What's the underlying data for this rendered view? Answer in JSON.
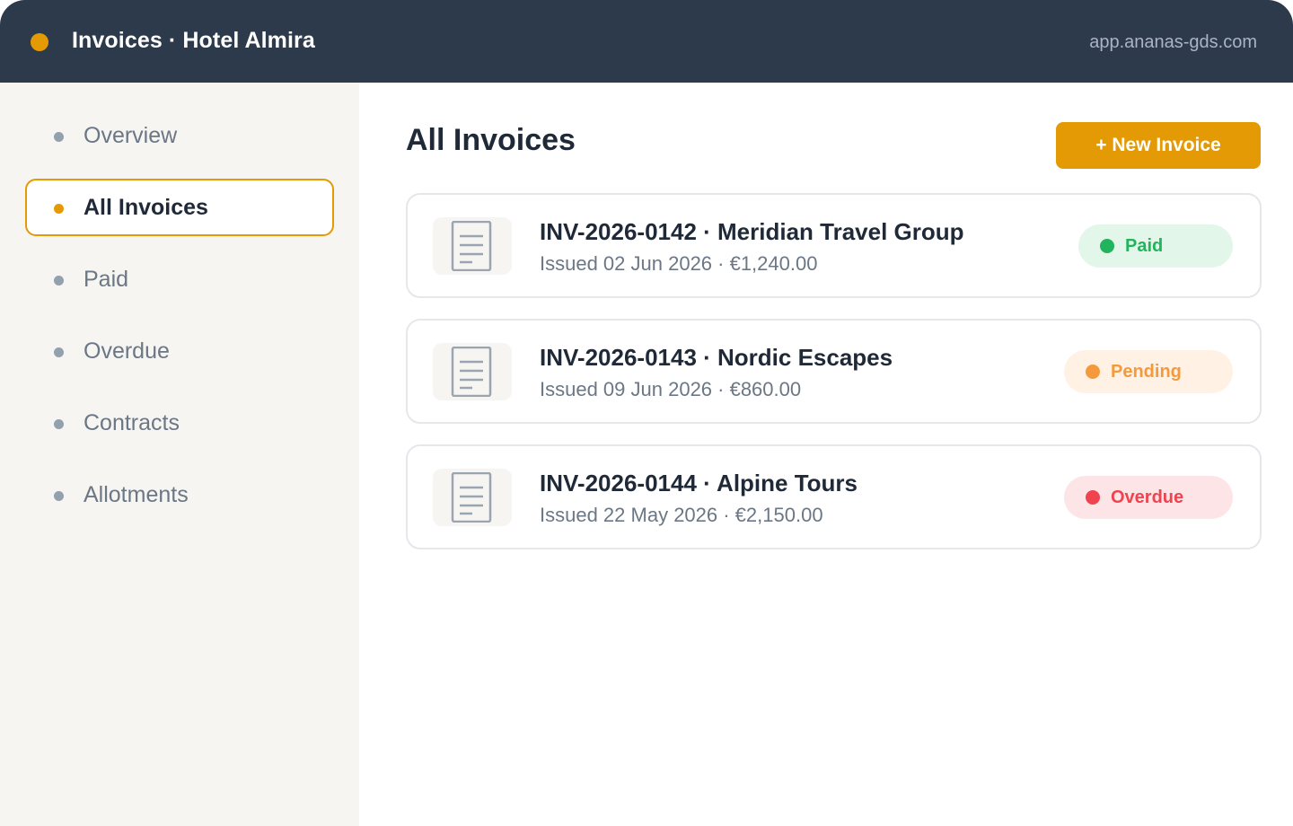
{
  "header": {
    "title": "Invoices · Hotel Almira",
    "url": "app.ananas-gds.com"
  },
  "sidebar": {
    "items": [
      {
        "label": "Overview",
        "active": false
      },
      {
        "label": "All Invoices",
        "active": true
      },
      {
        "label": "Paid",
        "active": false
      },
      {
        "label": "Overdue",
        "active": false
      },
      {
        "label": "Contracts",
        "active": false
      },
      {
        "label": "Allotments",
        "active": false
      }
    ]
  },
  "main": {
    "title": "All Invoices",
    "new_button_label": "+ New Invoice",
    "invoices": [
      {
        "title": "INV-2026-0142 · Meridian Travel Group",
        "meta": "Issued 02 Jun 2026 · €1,240.00",
        "status": "Paid"
      },
      {
        "title": "INV-2026-0143 · Nordic Escapes",
        "meta": "Issued 09 Jun 2026 · €860.00",
        "status": "Pending"
      },
      {
        "title": "INV-2026-0144 · Alpine Tours",
        "meta": "Issued 22 May 2026 · €2,150.00",
        "status": "Overdue"
      }
    ]
  },
  "colors": {
    "accent": "#e39a04",
    "header_bg": "#2d3a4b",
    "paid_bg": "#e3f6ea",
    "paid_fg": "#22b45c",
    "pending_bg": "#fff2e4",
    "pending_fg": "#f59a3c",
    "overdue_bg": "#fde5e7",
    "overdue_fg": "#ef4350"
  },
  "icons": {
    "brand": "status-dot-icon",
    "invoice": "document-icon",
    "nav": "bullet-icon"
  }
}
